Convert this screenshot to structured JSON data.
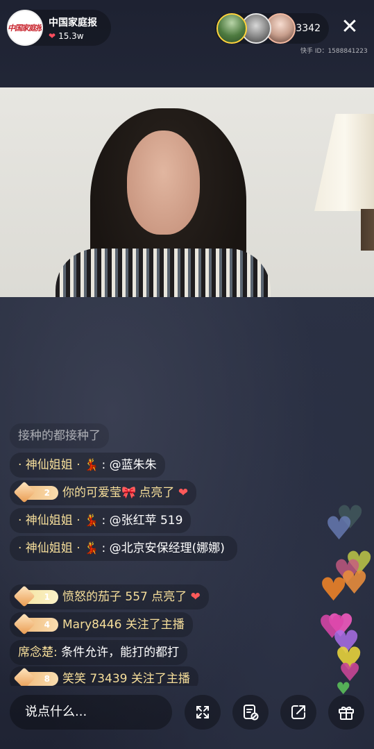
{
  "header": {
    "host_name": "中国家庭报",
    "host_logo_text": "中国家庭报",
    "likes": "15.3w",
    "viewer_count": "3342",
    "kuaishou_id": "快手 ID：1588841223"
  },
  "chat": [
    {
      "kind": "text",
      "text": "接种的都接种了"
    },
    {
      "kind": "mention",
      "name": "· 神仙姐姐 ·",
      "emoji": "💃",
      "text": ": @蓝朱朱"
    },
    {
      "kind": "badge",
      "level": "2",
      "name": "你的可爱莹",
      "emoji": "🎀",
      "text": "点亮了",
      "heart": "❤"
    },
    {
      "kind": "mention",
      "name": "· 神仙姐姐 ·",
      "emoji": "💃",
      "text": ": @张红苹 519"
    },
    {
      "kind": "mention",
      "name": "· 神仙姐姐 ·",
      "emoji": "💃",
      "text": ": @北京安保经理(娜娜)"
    },
    {
      "kind": "badge",
      "level": "1",
      "name": "愤怒的茄子 557",
      "emoji": "",
      "text": "点亮了",
      "heart": "❤"
    },
    {
      "kind": "badge",
      "level": "4",
      "name": "Mary8446",
      "emoji": "",
      "text": "关注了主播",
      "heart": ""
    },
    {
      "kind": "plain",
      "name": "席念楚:",
      "text": "条件允许，能打的都打"
    },
    {
      "kind": "badge",
      "level": "8",
      "name": "笑笑 73439",
      "emoji": "",
      "text": "关注了主播",
      "heart": ""
    }
  ],
  "footer": {
    "input_placeholder": "说点什么...",
    "icons": [
      "expand-icon",
      "clear-screen-icon",
      "share-icon",
      "gift-icon"
    ]
  },
  "colors": {
    "name_gold": "#f7df9b",
    "heart_red": "#ff4d5e",
    "badge_gold": "#f0b878"
  }
}
